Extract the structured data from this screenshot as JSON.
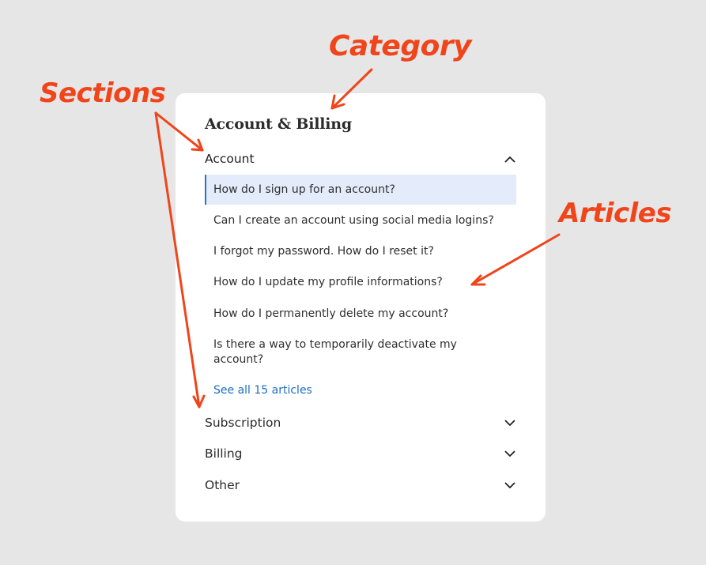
{
  "category": {
    "title": "Account & Billing"
  },
  "sections": [
    {
      "label": "Account",
      "expanded": true,
      "chevron": "chevron-up-icon",
      "articles": [
        "How do I sign up for an account?",
        "Can I create an account using social media logins?",
        "I forgot my password. How do I reset it?",
        "How do I update my profile informations?",
        "How do I permanently delete my account?",
        "Is there a way to temporarily deactivate my account?"
      ],
      "selected_article": "How do I sign up for an account?",
      "see_all": "See all 15 articles"
    },
    {
      "label": "Subscription",
      "expanded": false,
      "chevron": "chevron-down-icon"
    },
    {
      "label": "Billing",
      "expanded": false,
      "chevron": "chevron-down-icon"
    },
    {
      "label": "Other",
      "expanded": false,
      "chevron": "chevron-down-icon"
    }
  ],
  "annotations": {
    "category": "Category",
    "sections": "Sections",
    "articles": "Articles"
  },
  "colors": {
    "background": "#e6e6e6",
    "card": "#ffffff",
    "selected_bg": "#e4ecfb",
    "selected_border": "#2f6fc8",
    "link": "#1b6ec2",
    "annotation": "#f0441b"
  }
}
